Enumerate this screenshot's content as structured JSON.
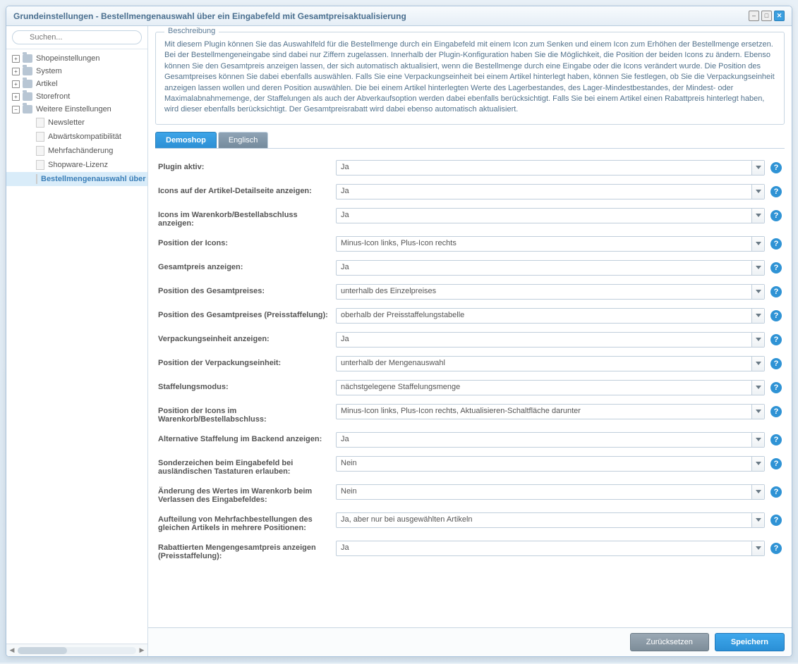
{
  "window": {
    "title": "Grundeinstellungen - Bestellmengenauswahl über ein Eingabefeld mit Gesamtpreisaktualisierung"
  },
  "search": {
    "placeholder": "Suchen..."
  },
  "tree": {
    "items": [
      {
        "label": "Shopeinstellungen",
        "type": "folder",
        "expander": "+"
      },
      {
        "label": "System",
        "type": "folder",
        "expander": "+"
      },
      {
        "label": "Artikel",
        "type": "folder",
        "expander": "+"
      },
      {
        "label": "Storefront",
        "type": "folder",
        "expander": "+"
      },
      {
        "label": "Weitere Einstellungen",
        "type": "folder",
        "expander": "−"
      }
    ],
    "leaves": [
      {
        "label": "Newsletter"
      },
      {
        "label": "Abwärtskompatibilität"
      },
      {
        "label": "Mehrfachänderung"
      },
      {
        "label": "Shopware-Lizenz"
      },
      {
        "label": "Bestellmengenauswahl über e"
      }
    ]
  },
  "description": {
    "legend": "Beschreibung",
    "text": "Mit diesem Plugin können Sie das Auswahlfeld für die Bestellmenge durch ein Eingabefeld mit einem Icon zum Senken und einem Icon zum Erhöhen der Bestellmenge ersetzen. Bei der Bestellmengeneingabe sind dabei nur Ziffern zugelassen. Innerhalb der Plugin-Konfiguration haben Sie die Möglichkeit, die Position der beiden Icons zu ändern. Ebenso können Sie den Gesamtpreis anzeigen lassen, der sich automatisch aktualisiert, wenn die Bestellmenge durch eine Eingabe oder die Icons verändert wurde. Die Position des Gesamtpreises können Sie dabei ebenfalls auswählen. Falls Sie eine Verpackungseinheit bei einem Artikel hinterlegt haben, können Sie festlegen, ob Sie die Verpackungseinheit anzeigen lassen wollen und deren Position auswählen. Die bei einem Artikel hinterlegten Werte des Lagerbestandes, des Lager-Mindestbestandes, der Mindest- oder Maximalabnahmemenge, der Staffelungen als auch der Abverkaufsoption werden dabei ebenfalls berücksichtigt. Falls Sie bei einem Artikel einen Rabattpreis hinterlegt haben, wird dieser ebenfalls berücksichtigt. Der Gesamtpreisrabatt wird dabei ebenso automatisch aktualisiert."
  },
  "tabs": [
    {
      "label": "Demoshop",
      "active": true
    },
    {
      "label": "Englisch",
      "active": false
    }
  ],
  "form": {
    "rows": [
      {
        "label": "Plugin aktiv:",
        "value": "Ja"
      },
      {
        "label": "Icons auf der Artikel-Detailseite anzeigen:",
        "value": "Ja"
      },
      {
        "label": "Icons im Warenkorb/Bestellabschluss anzeigen:",
        "value": "Ja"
      },
      {
        "label": "Position der Icons:",
        "value": "Minus-Icon links, Plus-Icon rechts"
      },
      {
        "label": "Gesamtpreis anzeigen:",
        "value": "Ja"
      },
      {
        "label": "Position des Gesamtpreises:",
        "value": "unterhalb des Einzelpreises"
      },
      {
        "label": "Position des Gesamtpreises (Preisstaffelung):",
        "value": "oberhalb der Preisstaffelungstabelle"
      },
      {
        "label": "Verpackungseinheit anzeigen:",
        "value": "Ja"
      },
      {
        "label": "Position der Verpackungseinheit:",
        "value": "unterhalb der Mengenauswahl"
      },
      {
        "label": "Staffelungsmodus:",
        "value": "nächstgelegene Staffelungsmenge"
      },
      {
        "label": "Position der Icons im Warenkorb/Bestellabschluss:",
        "value": "Minus-Icon links, Plus-Icon rechts, Aktualisieren-Schaltfläche darunter"
      },
      {
        "label": "Alternative Staffelung im Backend anzeigen:",
        "value": "Ja"
      },
      {
        "label": "Sonderzeichen beim Eingabefeld bei ausländischen Tastaturen erlauben:",
        "value": "Nein"
      },
      {
        "label": "Änderung des Wertes im Warenkorb beim Verlassen des Eingabefeldes:",
        "value": "Nein"
      },
      {
        "label": "Aufteilung von Mehrfachbestellungen des gleichen Artikels in mehrere Positionen:",
        "value": "Ja, aber nur bei ausgewählten Artikeln"
      },
      {
        "label": "Rabattierten Mengengesamtpreis anzeigen (Preisstaffelung):",
        "value": "Ja"
      }
    ]
  },
  "footer": {
    "reset": "Zurücksetzen",
    "save": "Speichern"
  }
}
